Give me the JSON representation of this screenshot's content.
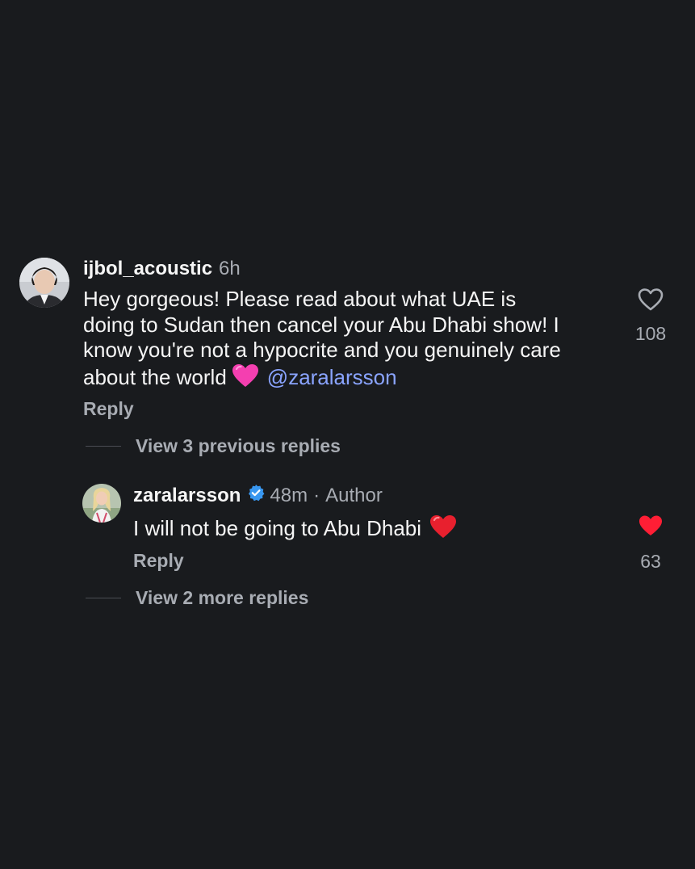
{
  "comment": {
    "username": "ijbol_acoustic",
    "time": "6h",
    "text_lines": [
      "Hey gorgeous! Please read about what UAE is",
      "doing to Sudan then cancel your Abu Dhabi show! I",
      "know you're not a hypocrite and you genuinely care",
      "about the world"
    ],
    "emoji": "pink-heart",
    "mention": "@zaralarsson",
    "reply_label": "Reply",
    "like_count": "108",
    "liked": false
  },
  "view_previous": {
    "label": "View 3 previous replies"
  },
  "reply": {
    "username": "zaralarsson",
    "verified": true,
    "time": "48m",
    "separator": "·",
    "role": "Author",
    "text": "I will not be going to Abu Dhabi",
    "emoji": "red-heart",
    "reply_label": "Reply",
    "like_count": "63",
    "liked": true
  },
  "view_more": {
    "label": "View 2 more replies"
  },
  "colors": {
    "background": "#191b1e",
    "text": "#f5f5f5",
    "muted": "#a8acb3",
    "mention": "#8aa4ff",
    "like_active": "#ff1e35",
    "verified": "#3897f0"
  }
}
